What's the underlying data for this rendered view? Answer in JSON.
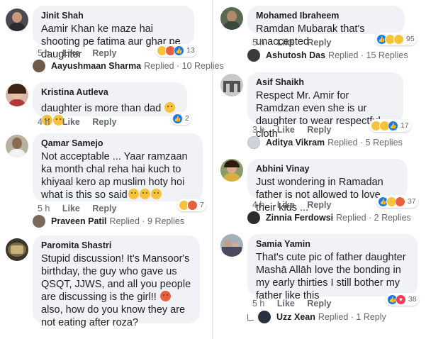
{
  "left": [
    {
      "author": "Jinit Shah",
      "text": "Aamir Khan ke maze hai shooting pe fatima aur ghar pe daughter",
      "time": "5 h",
      "like": "Like",
      "reply": "Reply",
      "reactions": [
        "haha",
        "angry",
        "like"
      ],
      "reaction_count": "13",
      "replies": {
        "name": "Aayushmaan Sharma",
        "rest": "Replied · 10 Replies"
      }
    },
    {
      "author": "Kristina Autleva",
      "text": "daughter is more than dad",
      "time": "4 h",
      "like": "Like",
      "reply": "Reply",
      "reactions": [
        "like"
      ],
      "reaction_count": "2"
    },
    {
      "author": "Qamar Samejo",
      "text": "Not acceptable ... Yaar ramzaan ka month chal reha hai kuch to khiyaal kero ap muslim hoty hoi what is this so said",
      "time": "5 h",
      "like": "Like",
      "reply": "Reply",
      "reactions": [
        "haha",
        "angry"
      ],
      "reaction_count": "7",
      "replies": {
        "name": "Praveen Patil",
        "rest": "Replied · 9 Replies"
      }
    },
    {
      "author": "Paromita Shastri",
      "text_a": "Stupid discussion! It's Mansoor's birthday, the guy who gave us QSQT, JJWS, and all you people are discussing is the girl!!",
      "text_b": "also, how do you know they are not eating after roza?"
    }
  ],
  "right": [
    {
      "author": "Mohamed Ibraheem",
      "text": "Ramdan Mubarak that's unaccepted",
      "time": "5 h",
      "like": "Like",
      "reply": "Reply",
      "reactions": [
        "like",
        "haha",
        "sad"
      ],
      "reaction_count": "95",
      "replies": {
        "name": "Ashutosh Das",
        "rest": "Replied · 15 Replies"
      }
    },
    {
      "author": "Asif Shaikh",
      "text": "Respect Mr. Amir for Ramdzan even she is ur daughter to wear respectful cloth",
      "time": "3 h",
      "like": "Like",
      "reply": "Reply",
      "reactions": [
        "haha",
        "wow",
        "like"
      ],
      "reaction_count": "17",
      "replies": {
        "name": "Aditya Vikram",
        "rest": "Replied · 5 Replies"
      }
    },
    {
      "author": "Abhini Vinay",
      "text": "Just wondering in Ramadan father is not allowed to love their kids ...",
      "time": "4 h",
      "like": "Like",
      "reply": "Reply",
      "reactions": [
        "like",
        "haha",
        "angry"
      ],
      "reaction_count": "37",
      "replies": {
        "name": "Zinnia Ferdowsi",
        "rest": "Replied · 2 Replies"
      }
    },
    {
      "author": "Samia Yamin",
      "text": "That's cute pic of father daughter Mashā Allāh love the bonding in my early thirties I still bother my father like this",
      "time": "5 h",
      "like": "Like",
      "reply": "Reply",
      "reactions": [
        "like",
        "love"
      ],
      "reaction_count": "38",
      "replies": {
        "name": "Uzz Xean",
        "rest": "Replied · 1 Reply"
      }
    }
  ],
  "colors": {
    "bubble": "#f0f2f5",
    "meta": "#65676b",
    "like_blue": "#1877f2",
    "love_red": "#f33e58",
    "haha_yellow": "#f7c23c",
    "angry_orange": "#e8603c"
  }
}
